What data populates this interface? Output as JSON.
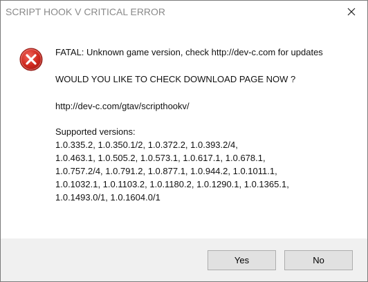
{
  "window": {
    "title": "SCRIPT HOOK V CRITICAL ERROR",
    "close_icon": "close-icon",
    "error_icon": "error-x-icon",
    "accent_error_color": "#c42b1c"
  },
  "message": {
    "line_fatal": "FATAL: Unknown game version, check http://dev-c.com for updates",
    "line_question": "WOULD YOU LIKE TO CHECK DOWNLOAD PAGE NOW ?",
    "line_url": "http://dev-c.com/gtav/scripthookv/",
    "supported_header": "Supported versions:",
    "supported_lines": [
      "1.0.335.2, 1.0.350.1/2, 1.0.372.2, 1.0.393.2/4,",
      "1.0.463.1, 1.0.505.2, 1.0.573.1, 1.0.617.1, 1.0.678.1,",
      "1.0.757.2/4, 1.0.791.2, 1.0.877.1, 1.0.944.2, 1.0.1011.1,",
      "1.0.1032.1, 1.0.1103.2, 1.0.1180.2, 1.0.1290.1, 1.0.1365.1,",
      "1.0.1493.0/1, 1.0.1604.0/1"
    ]
  },
  "buttons": {
    "yes_label": "Yes",
    "no_label": "No"
  }
}
